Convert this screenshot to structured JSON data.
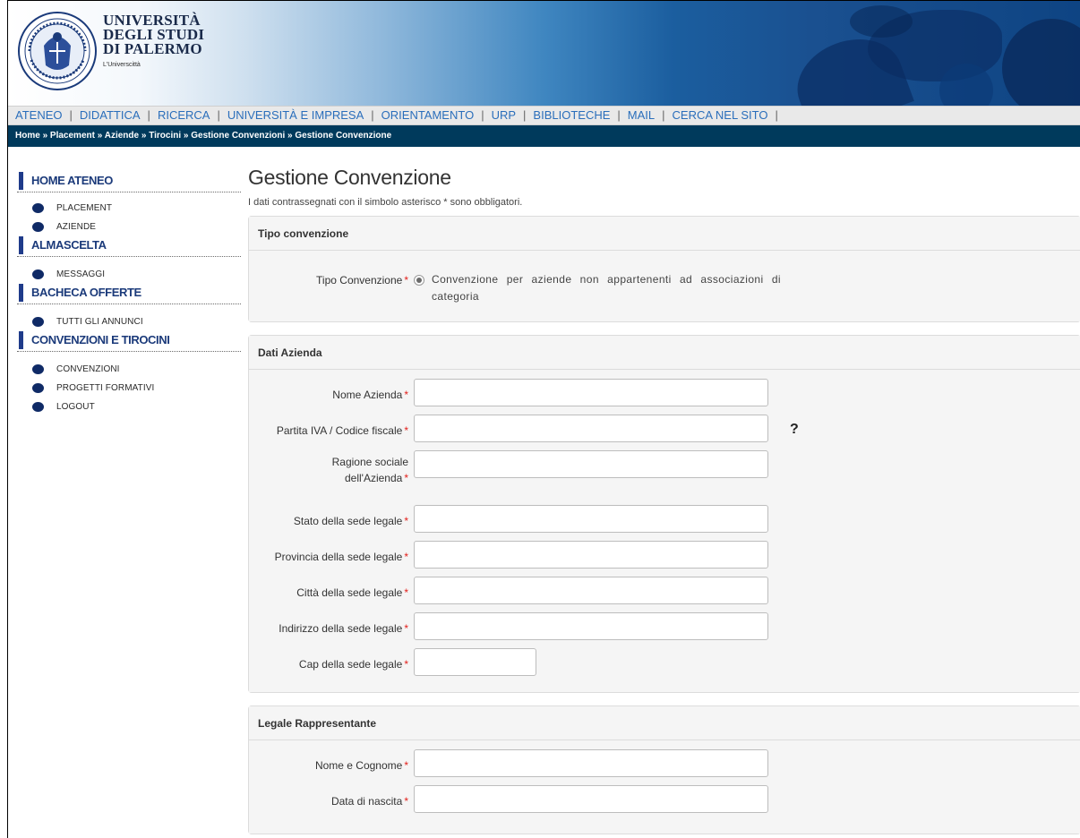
{
  "header": {
    "university_lines": [
      "UNIVERSITÀ",
      "DEGLI STUDI",
      "DI PALERMO"
    ],
    "tagline": "L'Universcittà"
  },
  "topnav": {
    "items": [
      "ATENEO",
      "DIDATTICA",
      "RICERCA",
      "UNIVERSITÀ E IMPRESA",
      "ORIENTAMENTO",
      "URP",
      "BIBLIOTECHE",
      "MAIL",
      "CERCA NEL SITO"
    ],
    "separator": "|"
  },
  "breadcrumb": {
    "items": [
      "Home",
      "Placement",
      "Aziende",
      "Tirocini",
      "Gestione Convenzioni",
      "Gestione Convenzione"
    ],
    "separator": "»"
  },
  "sidebar": {
    "sections": [
      {
        "title": "HOME ATENEO",
        "items": [
          "PLACEMENT",
          "AZIENDE"
        ]
      },
      {
        "title": "ALMASCELTA",
        "items": [
          "MESSAGGI"
        ]
      },
      {
        "title": "BACHECA OFFERTE",
        "items": [
          "TUTTI GLI ANNUNCI"
        ]
      },
      {
        "title": "CONVENZIONI E TIROCINI",
        "items": [
          "CONVENZIONI",
          "PROGETTI FORMATIVI",
          "LOGOUT"
        ]
      }
    ]
  },
  "main": {
    "title": "Gestione Convenzione",
    "note": "I dati contrassegnati con il simbolo asterisco * sono obbligatori.",
    "required_mark": "*",
    "tipo": {
      "heading": "Tipo convenzione",
      "label": "Tipo Convenzione",
      "option": "Convenzione per aziende non appartenenti ad associazioni di categoria"
    },
    "azienda": {
      "heading": "Dati Azienda",
      "fields": {
        "nome": "Nome Azienda",
        "piva": "Partita IVA / Codice fiscale",
        "ragione_1": "Ragione sociale",
        "ragione_2": "dell'Azienda",
        "stato": "Stato della sede legale",
        "provincia": "Provincia della sede legale",
        "citta": "Città della sede legale",
        "indirizzo": "Indirizzo della sede legale",
        "cap": "Cap della sede legale"
      },
      "help_glyph": "?"
    },
    "legale": {
      "heading": "Legale Rappresentante",
      "fields": {
        "nome_cognome": "Nome e Cognome",
        "data_nascita": "Data di nascita"
      }
    }
  },
  "colors": {
    "nav_link": "#2a6ebb",
    "breadcrumb_bg": "#003a5c",
    "sidebar_accent": "#1f3b8a",
    "required": "#e3201b"
  }
}
